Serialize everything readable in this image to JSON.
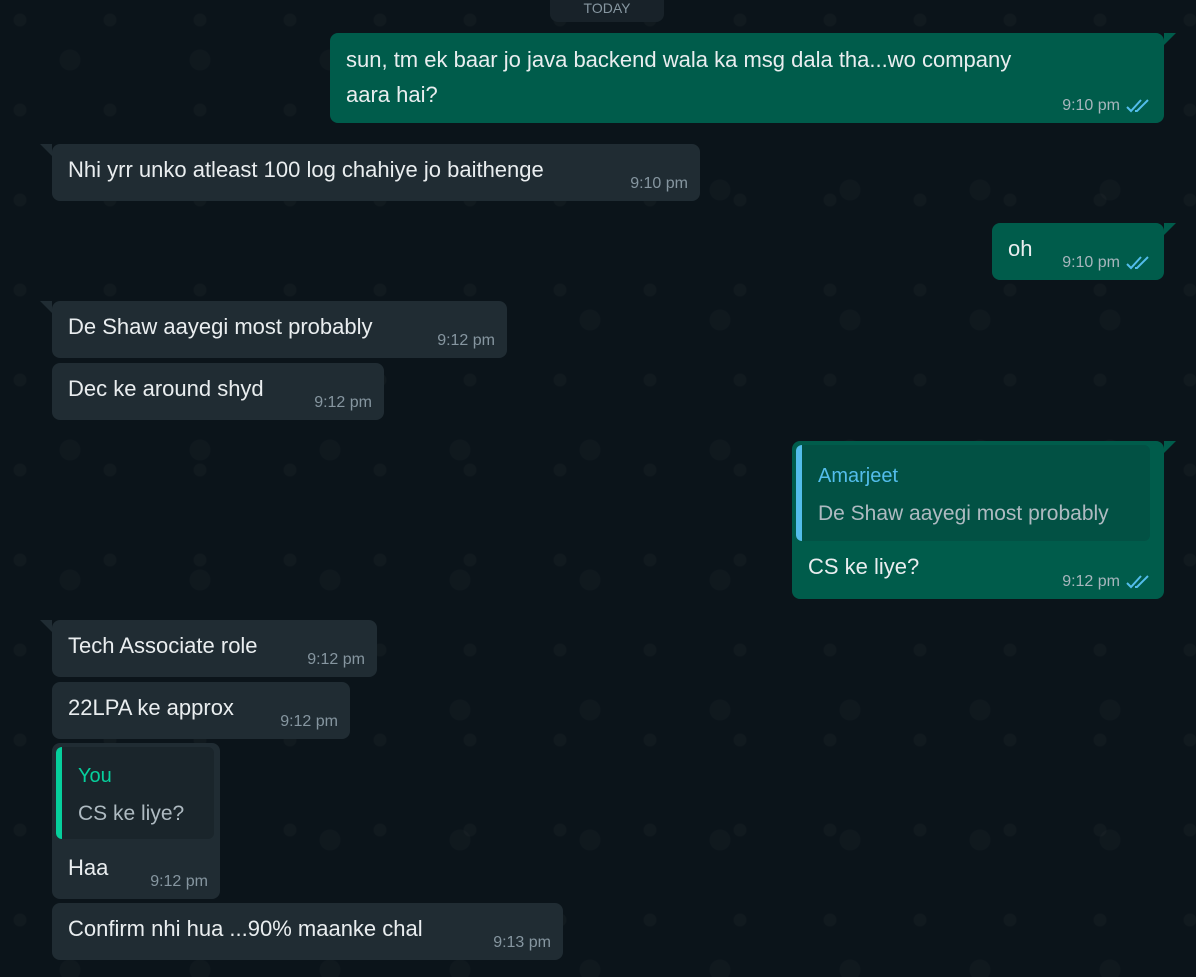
{
  "chat": {
    "date_chip": "TODAY",
    "messages": [
      {
        "line1": "sun, tm ek baar jo java backend wala ka msg dala tha...wo company",
        "line2": "aara hai?",
        "time": "9:10 pm"
      },
      {
        "text": "Nhi yrr unko atleast 100 log chahiye jo baithenge",
        "time": "9:10 pm"
      },
      {
        "text": "oh",
        "time": "9:10 pm"
      },
      {
        "text": "De Shaw aayegi most probably",
        "time": "9:12 pm"
      },
      {
        "text": "Dec ke around shyd",
        "time": "9:12 pm"
      },
      {
        "quote_author": "Amarjeet",
        "quote_text": "De Shaw aayegi most probably",
        "text": "CS ke liye?",
        "time": "9:12 pm"
      },
      {
        "text": "Tech Associate role",
        "time": "9:12 pm"
      },
      {
        "text": "22LPA ke approx",
        "time": "9:12 pm"
      },
      {
        "quote_author": "You",
        "quote_text": "CS ke liye?",
        "text": "Haa",
        "time": "9:12 pm"
      },
      {
        "text": "Confirm nhi hua ...90% maanke chal",
        "time": "9:13 pm"
      }
    ]
  },
  "colors": {
    "background": "#0b141a",
    "incoming_bubble": "#202c33",
    "outgoing_bubble": "#005c4b",
    "read_tick": "#53bdeb",
    "quote_amarjeet": "#53bdeb",
    "quote_you": "#06cf9c"
  },
  "icons": {
    "read_receipt": "double-check-icon"
  }
}
